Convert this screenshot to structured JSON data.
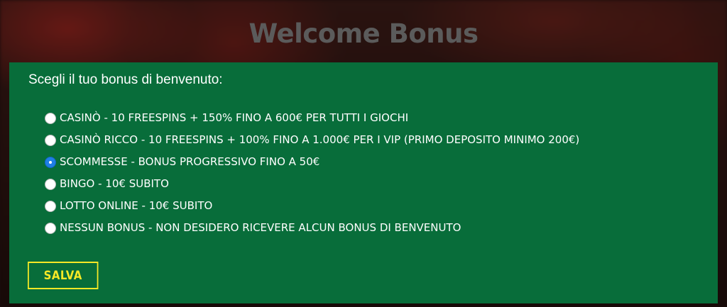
{
  "header": {
    "title": "Welcome Bonus"
  },
  "form": {
    "prompt": "Scegli il tuo bonus di benvenuto:",
    "selected_index": 2,
    "options": [
      {
        "label": "CASINÒ - 10 FREESPINS + 150% FINO A 600€ PER TUTTI I GIOCHI",
        "checked": false
      },
      {
        "label": "CASINÒ RICCO - 10 FREESPINS + 100% FINO A 1.000€ PER I VIP (PRIMO DEPOSITO MINIMO 200€)",
        "checked": false
      },
      {
        "label": "SCOMMESSE - BONUS PROGRESSIVO FINO A 50€",
        "checked": true
      },
      {
        "label": "BINGO - 10€ SUBITO",
        "checked": false
      },
      {
        "label": "LOTTO ONLINE - 10€ SUBITO",
        "checked": false
      },
      {
        "label": "NESSUN BONUS - NON DESIDERO RICEVERE ALCUN BONUS DI BENVENUTO",
        "checked": false
      }
    ],
    "save_label": "SALVA"
  },
  "colors": {
    "panel_background": "#086d3a",
    "button_accent": "#f6e826",
    "radio_selected": "#1f7fe6",
    "title_text": "#5b5b5b"
  }
}
